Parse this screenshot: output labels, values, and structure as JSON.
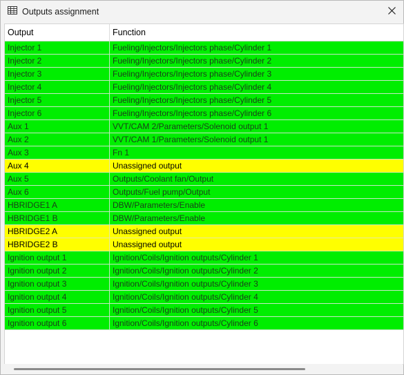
{
  "window": {
    "title": "Outputs assignment",
    "title_icon": "table-icon",
    "close_icon": "close-icon"
  },
  "colors": {
    "assigned": "#00ee00",
    "unassigned": "#ffff00",
    "assigned_text": "#1a3d1a",
    "unassigned_text": "#000000"
  },
  "table": {
    "headers": [
      "Output",
      "Function"
    ],
    "rows": [
      {
        "output": "Injector 1",
        "function": "Fueling/Injectors/Injectors phase/Cylinder 1",
        "status": "assigned"
      },
      {
        "output": "Injector 2",
        "function": "Fueling/Injectors/Injectors phase/Cylinder 2",
        "status": "assigned"
      },
      {
        "output": "Injector 3",
        "function": "Fueling/Injectors/Injectors phase/Cylinder 3",
        "status": "assigned"
      },
      {
        "output": "Injector 4",
        "function": "Fueling/Injectors/Injectors phase/Cylinder 4",
        "status": "assigned"
      },
      {
        "output": "Injector 5",
        "function": "Fueling/Injectors/Injectors phase/Cylinder 5",
        "status": "assigned"
      },
      {
        "output": "Injector 6",
        "function": "Fueling/Injectors/Injectors phase/Cylinder 6",
        "status": "assigned"
      },
      {
        "output": "Aux 1",
        "function": "VVT/CAM 2/Parameters/Solenoid output 1",
        "status": "assigned"
      },
      {
        "output": "Aux 2",
        "function": "VVT/CAM 1/Parameters/Solenoid output 1",
        "status": "assigned"
      },
      {
        "output": "Aux 3",
        "function": "Fn 1",
        "status": "assigned"
      },
      {
        "output": "Aux 4",
        "function": "Unassigned output",
        "status": "unassigned"
      },
      {
        "output": "Aux 5",
        "function": "Outputs/Coolant fan/Output",
        "status": "assigned"
      },
      {
        "output": "Aux 6",
        "function": "Outputs/Fuel pump/Output",
        "status": "assigned"
      },
      {
        "output": "HBRIDGE1 A",
        "function": "DBW/Parameters/Enable",
        "status": "assigned"
      },
      {
        "output": "HBRIDGE1 B",
        "function": "DBW/Parameters/Enable",
        "status": "assigned"
      },
      {
        "output": "HBRIDGE2 A",
        "function": "Unassigned output",
        "status": "unassigned"
      },
      {
        "output": "HBRIDGE2 B",
        "function": "Unassigned output",
        "status": "unassigned"
      },
      {
        "output": "Ignition output 1",
        "function": "Ignition/Coils/Ignition outputs/Cylinder 1",
        "status": "assigned"
      },
      {
        "output": "Ignition output 2",
        "function": "Ignition/Coils/Ignition outputs/Cylinder 2",
        "status": "assigned"
      },
      {
        "output": "Ignition output 3",
        "function": "Ignition/Coils/Ignition outputs/Cylinder 3",
        "status": "assigned"
      },
      {
        "output": "Ignition output 4",
        "function": "Ignition/Coils/Ignition outputs/Cylinder 4",
        "status": "assigned"
      },
      {
        "output": "Ignition output 5",
        "function": "Ignition/Coils/Ignition outputs/Cylinder 5",
        "status": "assigned"
      },
      {
        "output": "Ignition output 6",
        "function": "Ignition/Coils/Ignition outputs/Cylinder 6",
        "status": "assigned"
      }
    ]
  }
}
